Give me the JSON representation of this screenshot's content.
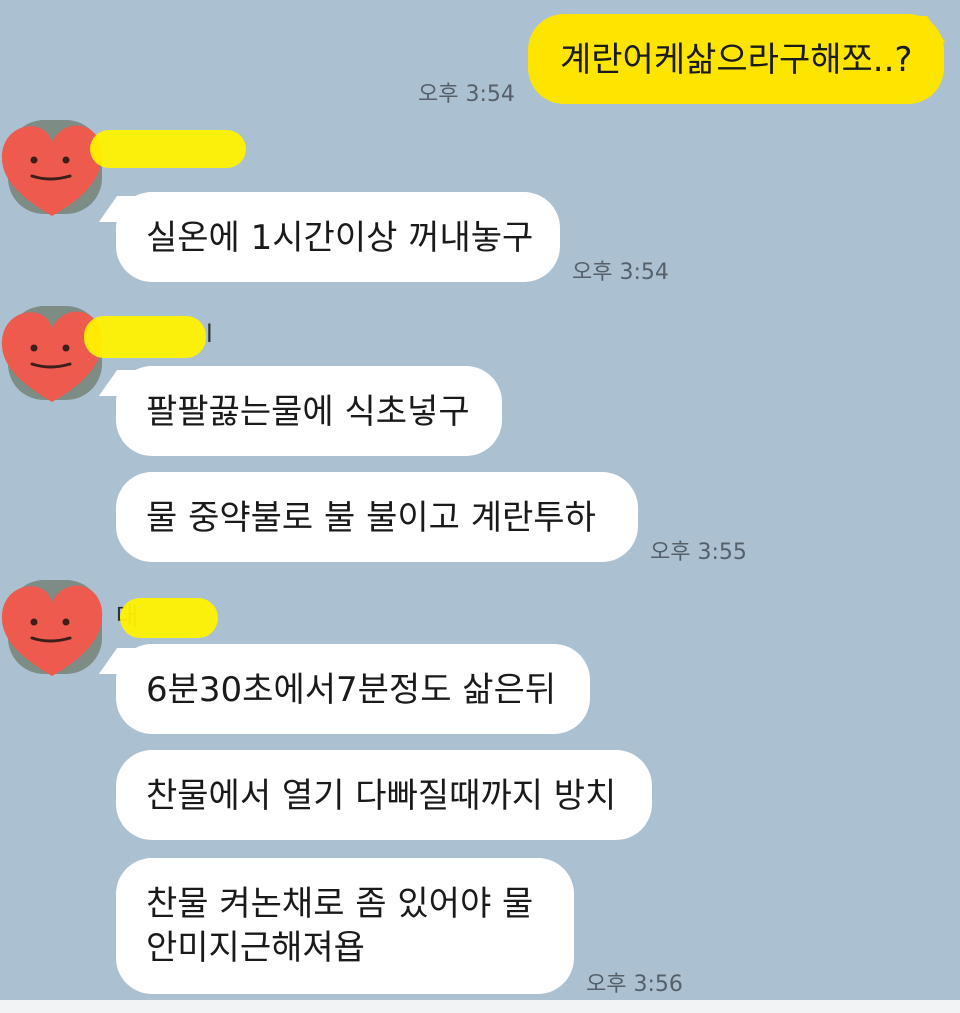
{
  "theme": {
    "background": "#abc1d1",
    "incoming_bubble": "#ffffff",
    "outgoing_bubble": "#fee500",
    "name_redaction": "#fff200",
    "avatar_sticker": "#ef5a4f"
  },
  "messages": [
    {
      "direction": "out",
      "text": "계란어케삶으라구해쪼..?",
      "time": "오후 3:54"
    },
    {
      "direction": "in",
      "text": "실온에 1시간이상 꺼내놓구",
      "time": "오후 3:54"
    },
    {
      "direction": "in",
      "text": "팔팔끓는물에 식초넣구"
    },
    {
      "direction": "in",
      "text": "물 중약불로 불 불이고 계란투하",
      "time": "오후 3:55"
    },
    {
      "direction": "in",
      "text": "6분30초에서7분정도 삶은뒤"
    },
    {
      "direction": "in",
      "text": "찬물에서 열기 다빠질때까지 방치"
    },
    {
      "direction": "in",
      "text_line1": "찬물 켜논채로 좀 있어야 물",
      "text_line2": "안미지근해져욥",
      "time": "오후 3:56"
    }
  ],
  "senders": [
    {
      "visible_fragment": ""
    },
    {
      "visible_fragment": "l"
    },
    {
      "visible_fragment": "대"
    }
  ],
  "icons": {
    "avatar": "heart-face-sticker-icon"
  }
}
